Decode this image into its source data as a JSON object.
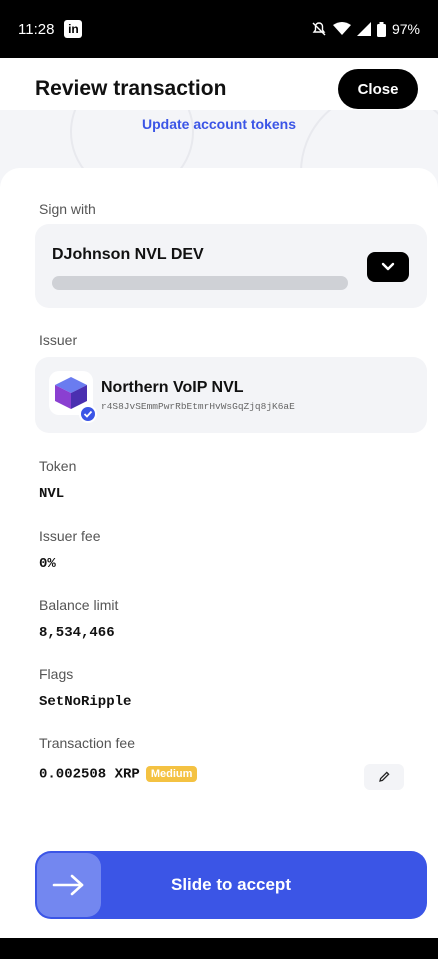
{
  "status_bar": {
    "time": "11:28",
    "app_badge": "in",
    "battery": "97%"
  },
  "header": {
    "title": "Review transaction",
    "close_label": "Close"
  },
  "banner": {
    "update_link": "Update account tokens"
  },
  "sign_with": {
    "label": "Sign with",
    "account_name": "DJohnson NVL DEV",
    "account_address_masked": "",
    "dropdown_icon": "chevron-down-icon"
  },
  "issuer": {
    "label": "Issuer",
    "name": "Northern VoIP NVL",
    "address": "r4S8JvSEmmPwrRbEtmrHvWsGqZjq8jK6aE",
    "verified_icon": "check-icon"
  },
  "token": {
    "label": "Token",
    "value": "NVL"
  },
  "issuer_fee": {
    "label": "Issuer fee",
    "value": "0%"
  },
  "balance_limit": {
    "label": "Balance limit",
    "value": "8,534,466"
  },
  "flags": {
    "label": "Flags",
    "value": "SetNoRipple"
  },
  "transaction_fee": {
    "label": "Transaction fee",
    "value": "0.002508 XRP",
    "level": "Medium",
    "level_color": "#f4c242",
    "edit_icon": "pencil-icon"
  },
  "slider": {
    "label": "Slide to accept",
    "icon": "arrow-right-icon",
    "accent": "#3b55e6"
  }
}
